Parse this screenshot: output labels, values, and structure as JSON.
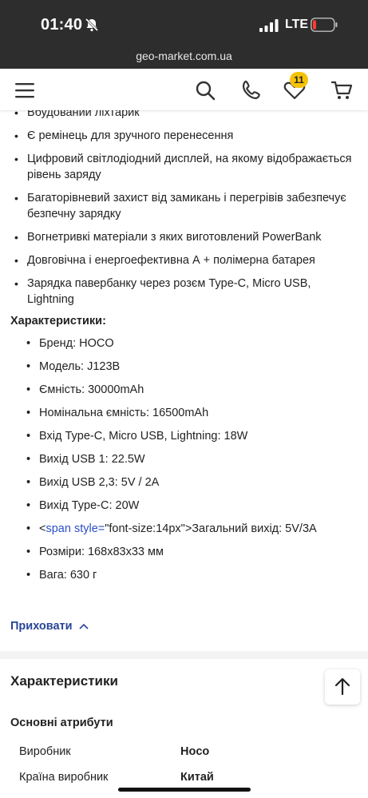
{
  "status_bar": {
    "time": "01:40",
    "network": "LTE"
  },
  "browser": {
    "url": "geo-market.com.ua"
  },
  "header": {
    "cart_badge_count": "11"
  },
  "features": [
    "Вбудований ліхтарик",
    "Є ремінець для зручного перенесення",
    "Цифровий світлодіодний дисплей, на якому відображається рівень заряду",
    "Багаторівневий захист від замикань і перегрівів забезпечує безпечну зарядку",
    "Вогнетривкі матеріали з яких виготовлений PowerBank",
    "Довговічна і енергоефективна А + полімерна батарея",
    "Зарядка  павербанку через розєм Type-C, Micro USB, Lightning"
  ],
  "specs_title": "Характеристики:",
  "specs": [
    "Бренд: HOCO",
    "Модель: J123B",
    "Ємність: 30000mAh",
    "Номінальна ємність: 16500mAh",
    "Вхід Type-C, Micro USB, Lightning: 18W",
    "Вихід USB 1: 22.5W",
    "Вихід USB 2,3: 5V / 2A",
    "Вихід Type-C: 20W",
    "Розміри: 168x83x33 мм",
    "Вага: 630 г"
  ],
  "raw_span": {
    "lt": "<",
    "tag": "span",
    "attr_name": " style=",
    "attr_value": "\"font-size:14px\"",
    "rest": ">Загальний вихід: 5V/3A"
  },
  "hide_label": "Приховати",
  "characteristics": {
    "title": "Характеристики",
    "group_title": "Основні атрибути",
    "rows": [
      {
        "key": "Виробник",
        "value": "Hoco"
      },
      {
        "key": "Країна виробник",
        "value": "Китай"
      }
    ]
  },
  "colors": {
    "link": "#2a4597",
    "badge": "#f5c20a",
    "statusbar": "#2d2d2d"
  }
}
